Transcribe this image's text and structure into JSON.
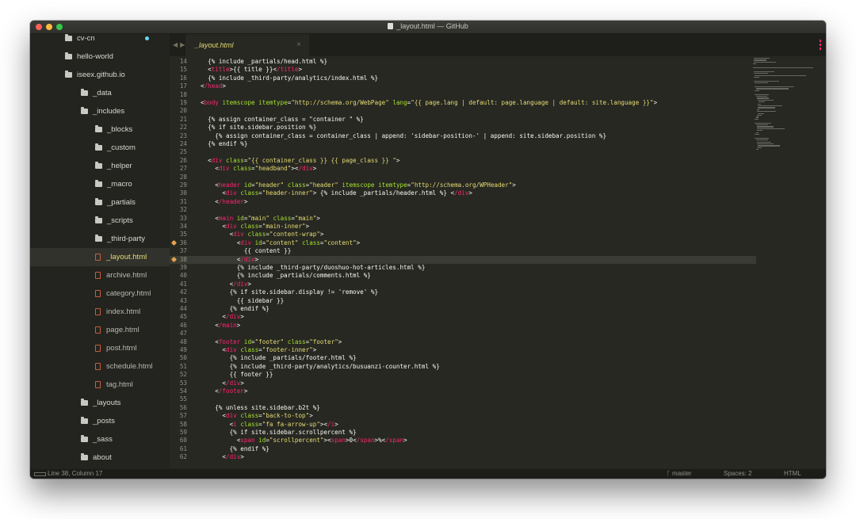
{
  "window": {
    "title": "_layout.html — GitHub"
  },
  "sidebar": {
    "items": [
      {
        "label": "cv-cn",
        "type": "folder",
        "indent": 1,
        "badge": true,
        "active": false
      },
      {
        "label": "hello-world",
        "type": "folder",
        "indent": 1,
        "active": false
      },
      {
        "label": "iseex.github.io",
        "type": "folder",
        "indent": 1,
        "active": false
      },
      {
        "label": "_data",
        "type": "folder",
        "indent": 2,
        "active": false
      },
      {
        "label": "_includes",
        "type": "folder",
        "indent": 2,
        "active": false
      },
      {
        "label": "_blocks",
        "type": "folder",
        "indent": 3,
        "active": false
      },
      {
        "label": "_custom",
        "type": "folder",
        "indent": 3,
        "active": false
      },
      {
        "label": "_helper",
        "type": "folder",
        "indent": 3,
        "active": false
      },
      {
        "label": "_macro",
        "type": "folder",
        "indent": 3,
        "active": false
      },
      {
        "label": "_partials",
        "type": "folder",
        "indent": 3,
        "active": false
      },
      {
        "label": "_scripts",
        "type": "folder",
        "indent": 3,
        "active": false
      },
      {
        "label": "_third-party",
        "type": "folder",
        "indent": 3,
        "active": false
      },
      {
        "label": "_layout.html",
        "type": "file",
        "indent": 3,
        "active": true
      },
      {
        "label": "archive.html",
        "type": "file",
        "indent": 3,
        "active": false
      },
      {
        "label": "category.html",
        "type": "file",
        "indent": 3,
        "active": false
      },
      {
        "label": "index.html",
        "type": "file",
        "indent": 3,
        "active": false
      },
      {
        "label": "page.html",
        "type": "file",
        "indent": 3,
        "active": false
      },
      {
        "label": "post.html",
        "type": "file",
        "indent": 3,
        "active": false
      },
      {
        "label": "schedule.html",
        "type": "file",
        "indent": 3,
        "active": false
      },
      {
        "label": "tag.html",
        "type": "file",
        "indent": 3,
        "active": false
      },
      {
        "label": "_layouts",
        "type": "folder",
        "indent": 2,
        "active": false
      },
      {
        "label": "_posts",
        "type": "folder",
        "indent": 2,
        "active": false
      },
      {
        "label": "_sass",
        "type": "folder",
        "indent": 2,
        "active": false
      },
      {
        "label": "about",
        "type": "folder",
        "indent": 2,
        "active": false
      }
    ]
  },
  "tabs": [
    {
      "label": "_layout.html",
      "close": "×"
    }
  ],
  "nav": {
    "back": "◀",
    "forward": "▶"
  },
  "editor": {
    "current_line": 38,
    "lines": [
      {
        "n": 14,
        "t": "  {% include _partials/head.html %}"
      },
      {
        "n": 15,
        "t": "  <title>{{ title }}</title>"
      },
      {
        "n": 16,
        "t": "  {% include _third-party/analytics/index.html %}"
      },
      {
        "n": 17,
        "t": "</head>"
      },
      {
        "n": 18,
        "t": ""
      },
      {
        "n": 19,
        "t": "<body itemscope itemtype=\"http://schema.org/WebPage\" lang=\"{{ page.lang | default: page.language | default: site.language }}\">"
      },
      {
        "n": 20,
        "t": ""
      },
      {
        "n": 21,
        "t": "  {% assign container_class = \"container \" %}"
      },
      {
        "n": 22,
        "t": "  {% if site.sidebar.position %}"
      },
      {
        "n": 23,
        "t": "    {% assign container_class = container_class | append: 'sidebar-position-' | append: site.sidebar.position %}"
      },
      {
        "n": 24,
        "t": "  {% endif %}"
      },
      {
        "n": 25,
        "t": ""
      },
      {
        "n": 26,
        "t": "  <div class=\"{{ container_class }} {{ page_class }} \">"
      },
      {
        "n": 27,
        "t": "    <div class=\"headband\"></div>"
      },
      {
        "n": 28,
        "t": ""
      },
      {
        "n": 29,
        "t": "    <header id=\"header\" class=\"header\" itemscope itemtype=\"http://schema.org/WPHeader\">"
      },
      {
        "n": 30,
        "t": "      <div class=\"header-inner\"> {% include _partials/header.html %} </div>"
      },
      {
        "n": 31,
        "t": "    </header>"
      },
      {
        "n": 32,
        "t": ""
      },
      {
        "n": 33,
        "t": "    <main id=\"main\" class=\"main\">"
      },
      {
        "n": 34,
        "t": "      <div class=\"main-inner\">"
      },
      {
        "n": 35,
        "t": "        <div class=\"content-wrap\">"
      },
      {
        "n": 36,
        "t": "          <div id=\"content\" class=\"content\">",
        "mark": true
      },
      {
        "n": 37,
        "t": "            {{ content }}"
      },
      {
        "n": 38,
        "t": "          </div>",
        "mark": true
      },
      {
        "n": 39,
        "t": "          {% include _third-party/duoshuo-hot-articles.html %}"
      },
      {
        "n": 40,
        "t": "          {% include _partials/comments.html %}"
      },
      {
        "n": 41,
        "t": "        </div>"
      },
      {
        "n": 42,
        "t": "        {% if site.sidebar.display != 'remove' %}"
      },
      {
        "n": 43,
        "t": "          {{ sidebar }}"
      },
      {
        "n": 44,
        "t": "        {% endif %}"
      },
      {
        "n": 45,
        "t": "      </div>"
      },
      {
        "n": 46,
        "t": "    </main>"
      },
      {
        "n": 47,
        "t": ""
      },
      {
        "n": 48,
        "t": "    <footer id=\"footer\" class=\"footer\">"
      },
      {
        "n": 49,
        "t": "      <div class=\"footer-inner\">"
      },
      {
        "n": 50,
        "t": "        {% include _partials/footer.html %}"
      },
      {
        "n": 51,
        "t": "        {% include _third-party/analytics/busuanzi-counter.html %}"
      },
      {
        "n": 52,
        "t": "        {{ footer }}"
      },
      {
        "n": 53,
        "t": "      </div>"
      },
      {
        "n": 54,
        "t": "    </footer>"
      },
      {
        "n": 55,
        "t": ""
      },
      {
        "n": 56,
        "t": "    {% unless site.sidebar.b2t %}"
      },
      {
        "n": 57,
        "t": "      <div class=\"back-to-top\">"
      },
      {
        "n": 58,
        "t": "        <i class=\"fa fa-arrow-up\"></i>"
      },
      {
        "n": 59,
        "t": "        {% if site.sidebar.scrollpercent %}"
      },
      {
        "n": 60,
        "t": "          <span id=\"scrollpercent\"><span>0</span>%</span>"
      },
      {
        "n": 61,
        "t": "        {% endif %}"
      },
      {
        "n": 62,
        "t": "      </div>"
      }
    ]
  },
  "status": {
    "position": "Line 38, Column 17",
    "branch": "master",
    "spaces": "Spaces: 2",
    "syntax": "HTML"
  },
  "colors": {
    "background": "#272822",
    "sidebar": "#23241f",
    "tag": "#f92672",
    "attribute": "#a6e22e",
    "string": "#e6db74",
    "text": "#f8f8f2"
  }
}
